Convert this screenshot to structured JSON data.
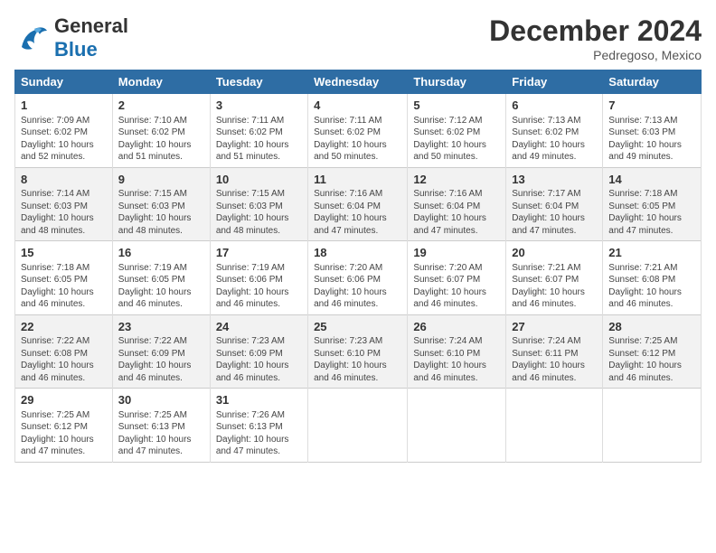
{
  "header": {
    "logo_general": "General",
    "logo_blue": "Blue",
    "month_title": "December 2024",
    "location": "Pedregoso, Mexico"
  },
  "days_of_week": [
    "Sunday",
    "Monday",
    "Tuesday",
    "Wednesday",
    "Thursday",
    "Friday",
    "Saturday"
  ],
  "weeks": [
    [
      {
        "day": "1",
        "info": "Sunrise: 7:09 AM\nSunset: 6:02 PM\nDaylight: 10 hours\nand 52 minutes."
      },
      {
        "day": "2",
        "info": "Sunrise: 7:10 AM\nSunset: 6:02 PM\nDaylight: 10 hours\nand 51 minutes."
      },
      {
        "day": "3",
        "info": "Sunrise: 7:11 AM\nSunset: 6:02 PM\nDaylight: 10 hours\nand 51 minutes."
      },
      {
        "day": "4",
        "info": "Sunrise: 7:11 AM\nSunset: 6:02 PM\nDaylight: 10 hours\nand 50 minutes."
      },
      {
        "day": "5",
        "info": "Sunrise: 7:12 AM\nSunset: 6:02 PM\nDaylight: 10 hours\nand 50 minutes."
      },
      {
        "day": "6",
        "info": "Sunrise: 7:13 AM\nSunset: 6:02 PM\nDaylight: 10 hours\nand 49 minutes."
      },
      {
        "day": "7",
        "info": "Sunrise: 7:13 AM\nSunset: 6:03 PM\nDaylight: 10 hours\nand 49 minutes."
      }
    ],
    [
      {
        "day": "8",
        "info": "Sunrise: 7:14 AM\nSunset: 6:03 PM\nDaylight: 10 hours\nand 48 minutes."
      },
      {
        "day": "9",
        "info": "Sunrise: 7:15 AM\nSunset: 6:03 PM\nDaylight: 10 hours\nand 48 minutes."
      },
      {
        "day": "10",
        "info": "Sunrise: 7:15 AM\nSunset: 6:03 PM\nDaylight: 10 hours\nand 48 minutes."
      },
      {
        "day": "11",
        "info": "Sunrise: 7:16 AM\nSunset: 6:04 PM\nDaylight: 10 hours\nand 47 minutes."
      },
      {
        "day": "12",
        "info": "Sunrise: 7:16 AM\nSunset: 6:04 PM\nDaylight: 10 hours\nand 47 minutes."
      },
      {
        "day": "13",
        "info": "Sunrise: 7:17 AM\nSunset: 6:04 PM\nDaylight: 10 hours\nand 47 minutes."
      },
      {
        "day": "14",
        "info": "Sunrise: 7:18 AM\nSunset: 6:05 PM\nDaylight: 10 hours\nand 47 minutes."
      }
    ],
    [
      {
        "day": "15",
        "info": "Sunrise: 7:18 AM\nSunset: 6:05 PM\nDaylight: 10 hours\nand 46 minutes."
      },
      {
        "day": "16",
        "info": "Sunrise: 7:19 AM\nSunset: 6:05 PM\nDaylight: 10 hours\nand 46 minutes."
      },
      {
        "day": "17",
        "info": "Sunrise: 7:19 AM\nSunset: 6:06 PM\nDaylight: 10 hours\nand 46 minutes."
      },
      {
        "day": "18",
        "info": "Sunrise: 7:20 AM\nSunset: 6:06 PM\nDaylight: 10 hours\nand 46 minutes."
      },
      {
        "day": "19",
        "info": "Sunrise: 7:20 AM\nSunset: 6:07 PM\nDaylight: 10 hours\nand 46 minutes."
      },
      {
        "day": "20",
        "info": "Sunrise: 7:21 AM\nSunset: 6:07 PM\nDaylight: 10 hours\nand 46 minutes."
      },
      {
        "day": "21",
        "info": "Sunrise: 7:21 AM\nSunset: 6:08 PM\nDaylight: 10 hours\nand 46 minutes."
      }
    ],
    [
      {
        "day": "22",
        "info": "Sunrise: 7:22 AM\nSunset: 6:08 PM\nDaylight: 10 hours\nand 46 minutes."
      },
      {
        "day": "23",
        "info": "Sunrise: 7:22 AM\nSunset: 6:09 PM\nDaylight: 10 hours\nand 46 minutes."
      },
      {
        "day": "24",
        "info": "Sunrise: 7:23 AM\nSunset: 6:09 PM\nDaylight: 10 hours\nand 46 minutes."
      },
      {
        "day": "25",
        "info": "Sunrise: 7:23 AM\nSunset: 6:10 PM\nDaylight: 10 hours\nand 46 minutes."
      },
      {
        "day": "26",
        "info": "Sunrise: 7:24 AM\nSunset: 6:10 PM\nDaylight: 10 hours\nand 46 minutes."
      },
      {
        "day": "27",
        "info": "Sunrise: 7:24 AM\nSunset: 6:11 PM\nDaylight: 10 hours\nand 46 minutes."
      },
      {
        "day": "28",
        "info": "Sunrise: 7:25 AM\nSunset: 6:12 PM\nDaylight: 10 hours\nand 46 minutes."
      }
    ],
    [
      {
        "day": "29",
        "info": "Sunrise: 7:25 AM\nSunset: 6:12 PM\nDaylight: 10 hours\nand 47 minutes."
      },
      {
        "day": "30",
        "info": "Sunrise: 7:25 AM\nSunset: 6:13 PM\nDaylight: 10 hours\nand 47 minutes."
      },
      {
        "day": "31",
        "info": "Sunrise: 7:26 AM\nSunset: 6:13 PM\nDaylight: 10 hours\nand 47 minutes."
      },
      {
        "day": "",
        "info": ""
      },
      {
        "day": "",
        "info": ""
      },
      {
        "day": "",
        "info": ""
      },
      {
        "day": "",
        "info": ""
      }
    ]
  ]
}
